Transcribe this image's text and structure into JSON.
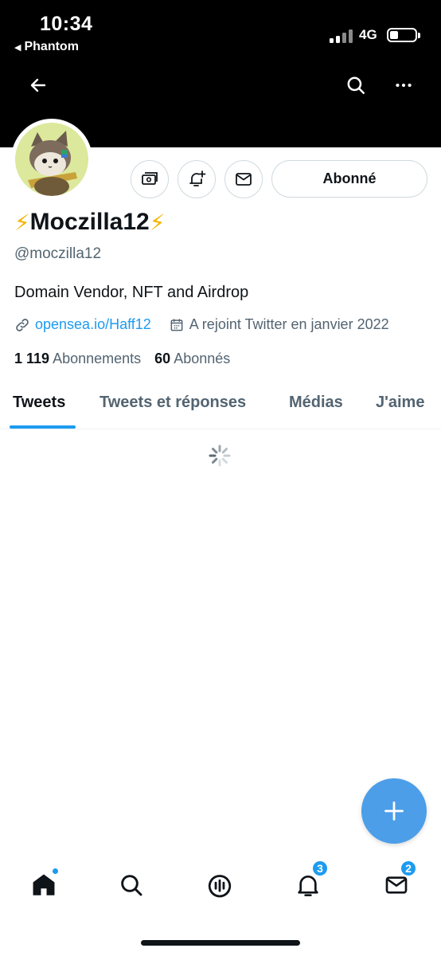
{
  "status_bar": {
    "time": "10:34",
    "back_app": "Phantom",
    "network": "4G"
  },
  "header": {
    "back_icon": "arrow-left-icon",
    "search_icon": "search-icon",
    "more_icon": "more-horizontal-icon"
  },
  "profile": {
    "avatar": "avatar",
    "name_prefix": "⚡",
    "name": "Moczilla12",
    "name_suffix": "⚡",
    "handle": "@moczilla12",
    "bio": "Domain Vendor, NFT and Airdrop",
    "link": "opensea.io/Haff12",
    "joined": "A rejoint Twitter en janvier 2022",
    "following_count": "1 119",
    "following_label": "Abonnements",
    "followers_count": "60",
    "followers_label": "Abonnés"
  },
  "actions": {
    "follow_label": "Abonné"
  },
  "tabs": [
    {
      "label": "Tweets",
      "active": true
    },
    {
      "label": "Tweets et réponses",
      "active": false
    },
    {
      "label": "Médias",
      "active": false
    },
    {
      "label": "J'aime",
      "active": false
    }
  ],
  "bottom_nav": {
    "notifications_badge": "3",
    "messages_badge": "2"
  },
  "colors": {
    "accent": "#1d9bf0",
    "fab": "#4c9ee8",
    "text_primary": "#0f1419",
    "text_secondary": "#536471"
  }
}
